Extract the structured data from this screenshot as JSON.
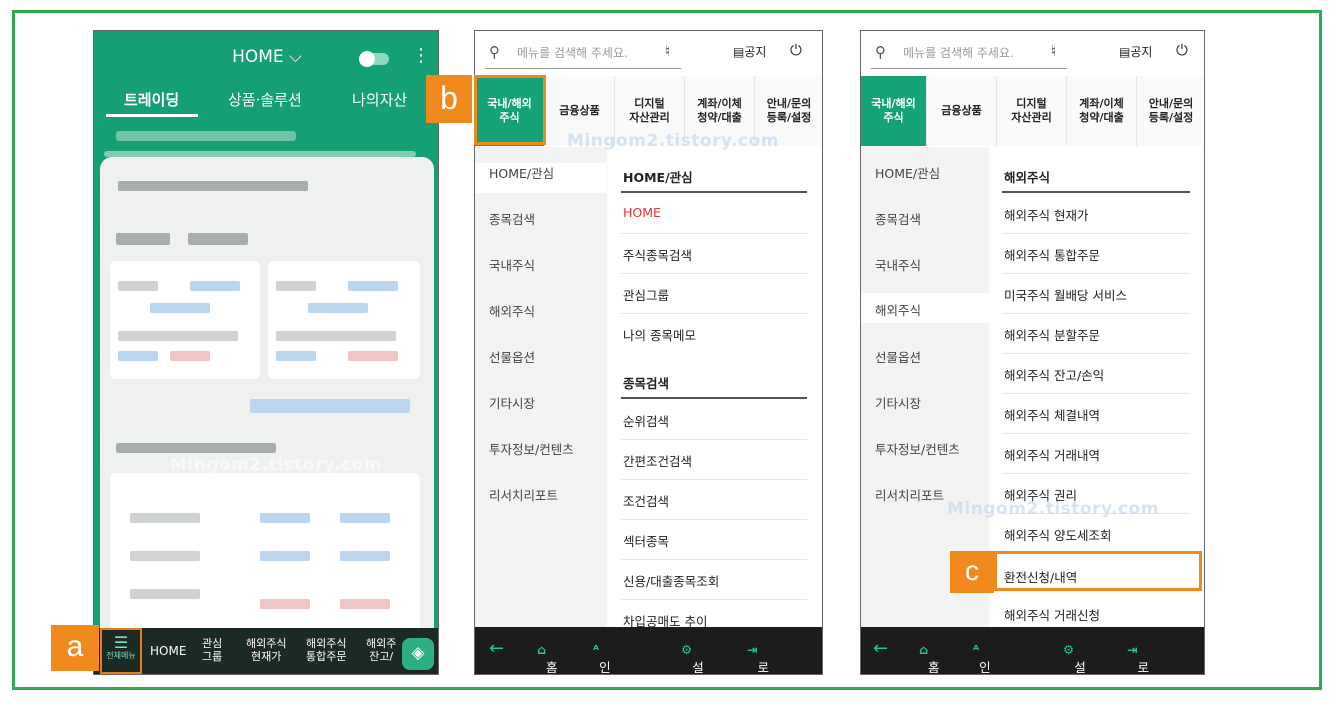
{
  "colors": {
    "frame": "#2eaa4f",
    "app_green": "#14a074",
    "accent_orange": "#f08a1f"
  },
  "phone1": {
    "header_title": "HOME ⌵",
    "tabs": [
      "트레이딩",
      "상품·솔루션",
      "나의자산"
    ],
    "menu_label": "전체메뉴",
    "bottom_nav": [
      "HOME",
      "관심\n그룹",
      "해외주식\n현재가",
      "해외주식\n통합주문",
      "해외주\n잔고/"
    ],
    "watermark": "Mingom2.tistory.com"
  },
  "phone2": {
    "search_placeholder": "메뉴를 검색해 주세요.",
    "notice": "공지",
    "tabs": [
      "국내/해외\n주식",
      "금융상품",
      "디지털\n자산관리",
      "계좌/이체\n청약/대출",
      "안내/문의\n등록/설정"
    ],
    "side": [
      "HOME/관심",
      "종목검색",
      "국내주식",
      "해외주식",
      "선물옵션",
      "기타시장",
      "투자정보/컨텐츠",
      "리서치리포트"
    ],
    "section1": "HOME/관심",
    "items1": [
      "HOME",
      "주식종목검색",
      "관심그룹",
      "나의 종목메모"
    ],
    "section2": "종목검색",
    "items2": [
      "순위검색",
      "간편조건검색",
      "조건검색",
      "섹터종목",
      "신용/대출종목조회",
      "차입공매도 추이"
    ],
    "bottom": {
      "home": "홈",
      "auth": "인증센터",
      "settings": "설정",
      "logout": "로그아웃"
    },
    "watermark": "Mingom2.tistory.com"
  },
  "phone3": {
    "search_placeholder": "메뉴를 검색해 주세요.",
    "notice": "공지",
    "tabs": [
      "국내/해외\n주식",
      "금융상품",
      "디지털\n자산관리",
      "계좌/이체\n청약/대출",
      "안내/문의\n등록/설정"
    ],
    "side": [
      "HOME/관심",
      "종목검색",
      "국내주식",
      "해외주식",
      "선물옵션",
      "기타시장",
      "투자정보/컨텐츠",
      "리서치리포트"
    ],
    "section": "해외주식",
    "items": [
      "해외주식 현재가",
      "해외주식 통합주문",
      "미국주식 월배당 서비스",
      "해외주식 분할주문",
      "해외주식 잔고/손익",
      "해외주식 체결내역",
      "해외주식 거래내역",
      "해외주식 권리",
      "해외주식 양도세조회",
      "환전신청/내역",
      "해외주식 거래신청"
    ],
    "bottom": {
      "home": "홈",
      "auth": "인증센터",
      "settings": "설정",
      "logout": "로그아웃"
    },
    "watermark": "Mingom2.tistory.com"
  },
  "labels": {
    "a": "a",
    "b": "b",
    "c": "c"
  }
}
